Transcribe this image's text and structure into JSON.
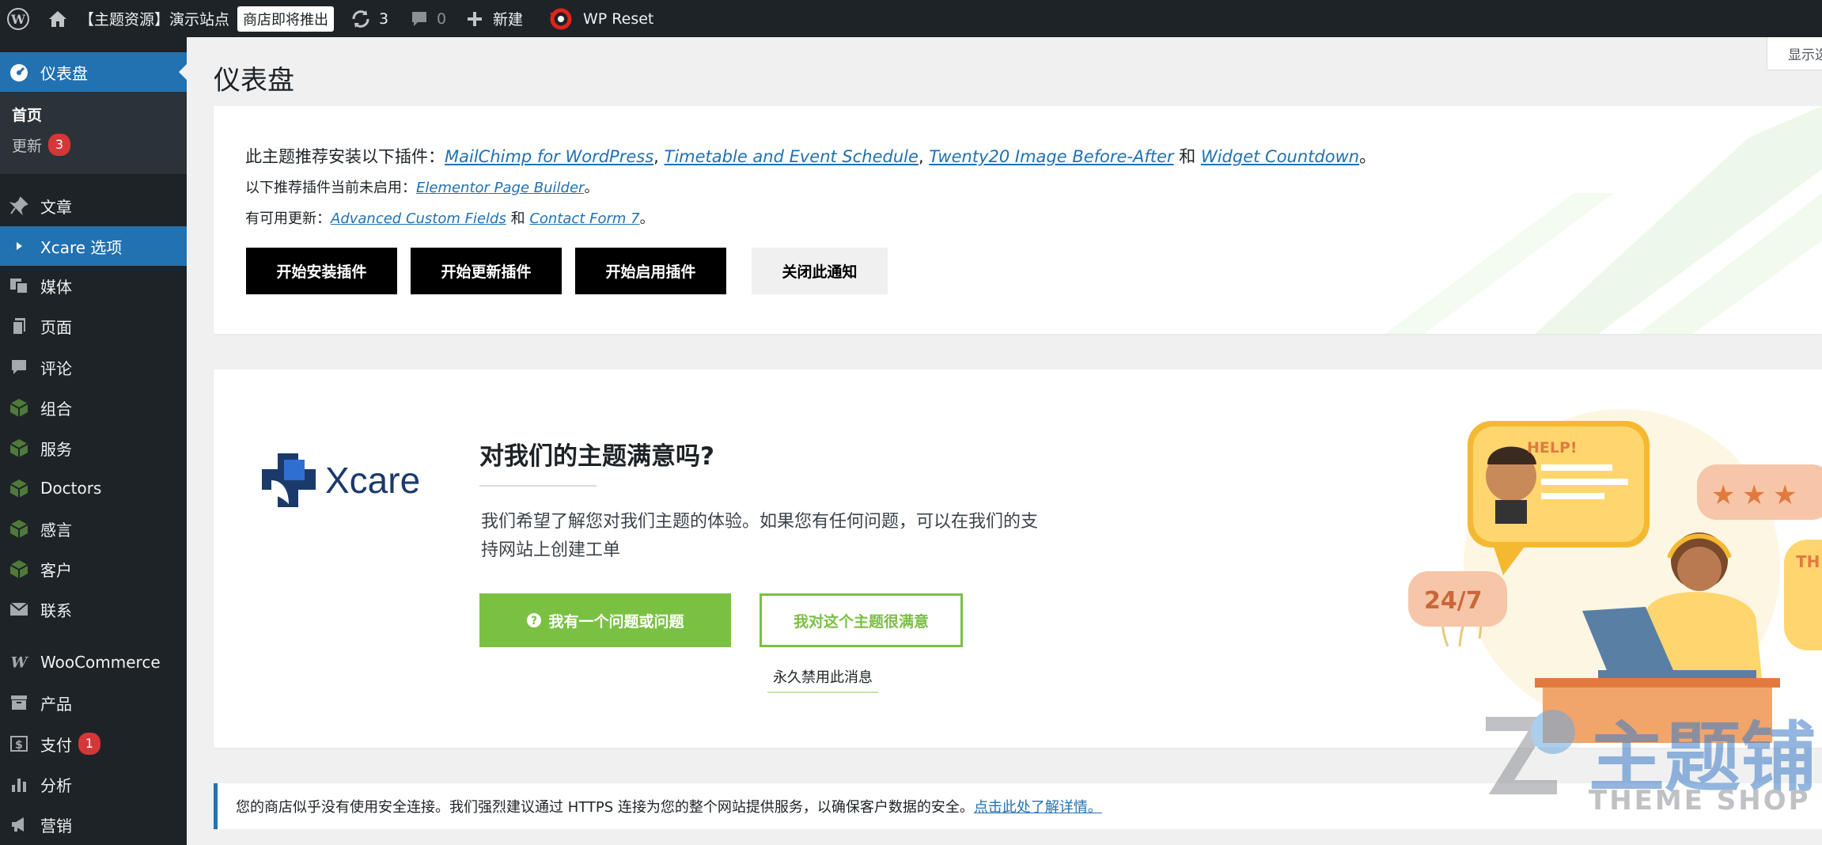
{
  "adminbar": {
    "site_name": "【主题资源】演示站点",
    "store_badge": "商店即将推出",
    "updates_count": "3",
    "comments_count": "0",
    "new_label": "新建",
    "wp_reset": "WP Reset"
  },
  "screen_options": "显示选",
  "sidebar": {
    "dashboard": "仪表盘",
    "home": "首页",
    "updates": "更新",
    "updates_count": "3",
    "items": [
      "文章",
      "Xcare 选项",
      "媒体",
      "页面",
      "评论",
      "组合",
      "服务",
      "Doctors",
      "感言",
      "客户",
      "联系",
      "WooCommerce",
      "产品",
      "支付",
      "分析",
      "营销"
    ],
    "payments_count": "1"
  },
  "page_title": "仪表盘",
  "plugin_notice": {
    "line1_prefix": "此主题推荐安装以下插件：",
    "plugins_recommended": [
      "MailChimp for WordPress",
      "Timetable and Event Schedule",
      "Twenty20 Image Before-After",
      "Widget Countdown"
    ],
    "sep": ", ",
    "and": "和",
    "period": "。",
    "line2_prefix": "以下推荐插件当前未启用：",
    "inactive_plugin": "Elementor Page Builder",
    "line3_prefix": "有可用更新：",
    "update_plugins": [
      "Advanced Custom Fields",
      "Contact Form 7"
    ],
    "buttons": [
      "开始安装插件",
      "开始更新插件",
      "开始启用插件",
      "关闭此通知"
    ]
  },
  "feedback": {
    "logo_text": "Xcare",
    "title": "对我们的主题满意吗?",
    "body_line1": "我们希望了解您对我们主题的体验。如果您有任何问题，可以在我们的支",
    "body_line2": "持网站上创建工单",
    "btn_question": "我有一个问题或问题",
    "btn_happy": "我对这个主题很满意",
    "disable_link": "永久禁用此消息",
    "illus_help": "HELP!",
    "illus_247": "24/7",
    "illus_th": "TH"
  },
  "https_notice": {
    "text": "您的商店似乎没有使用安全连接。我们强烈建议通过 HTTPS 连接为您的整个网站提供服务，以确保客户数据的安全。",
    "link": "点击此处了解详情。"
  },
  "watermark": {
    "brand_cn": "主题铺",
    "brand_en": "THEME SHOP"
  },
  "colors": {
    "adminbar": "#1d2327",
    "accent": "#2271b1",
    "badge": "#d63638",
    "green": "#7ac143",
    "sidebar_sub": "#2c3338"
  }
}
